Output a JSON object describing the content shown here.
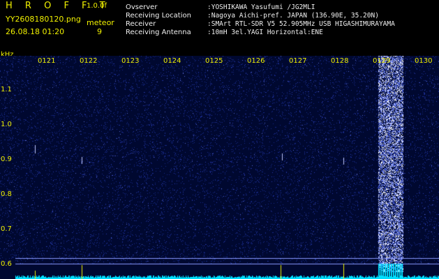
{
  "header": {
    "app_title": "H R O F F T",
    "version": "1.0.0f",
    "filename": "YY2608180120.png",
    "timestamp": "26.08.18 01:20",
    "mode_label": "meteor",
    "meteor_count": "9",
    "info": [
      {
        "label": "Ovserver",
        "value": ":YOSHIKAWA Yasufumi /JG2MLI"
      },
      {
        "label": "Receiving Location",
        "value": ":Nagoya Aichi-pref. JAPAN (136.90E, 35.20N)"
      },
      {
        "label": "Receiver",
        "value": ":SMArt RTL-SDR V5 52.905MHz USB HIGASHIMURAYAMA"
      },
      {
        "label": "Receiving Antenna",
        "value": ":10mH 3el.YAGI Horizontal:ENE"
      }
    ]
  },
  "spectrogram": {
    "y_unit": "kHz",
    "y_ticks": [
      "1.1",
      "1.0",
      "0.9",
      "0.8",
      "0.7",
      "0.6"
    ],
    "x_ticks": [
      "0121",
      "0122",
      "0123",
      "0124",
      "0125",
      "0126",
      "0127",
      "0128",
      "0129",
      "0130"
    ],
    "colors": {
      "background": "#000830",
      "noise": "#1a2a9a",
      "signal": "#ffffff",
      "trace": "#00e0ff",
      "label": "#f0f000"
    }
  }
}
